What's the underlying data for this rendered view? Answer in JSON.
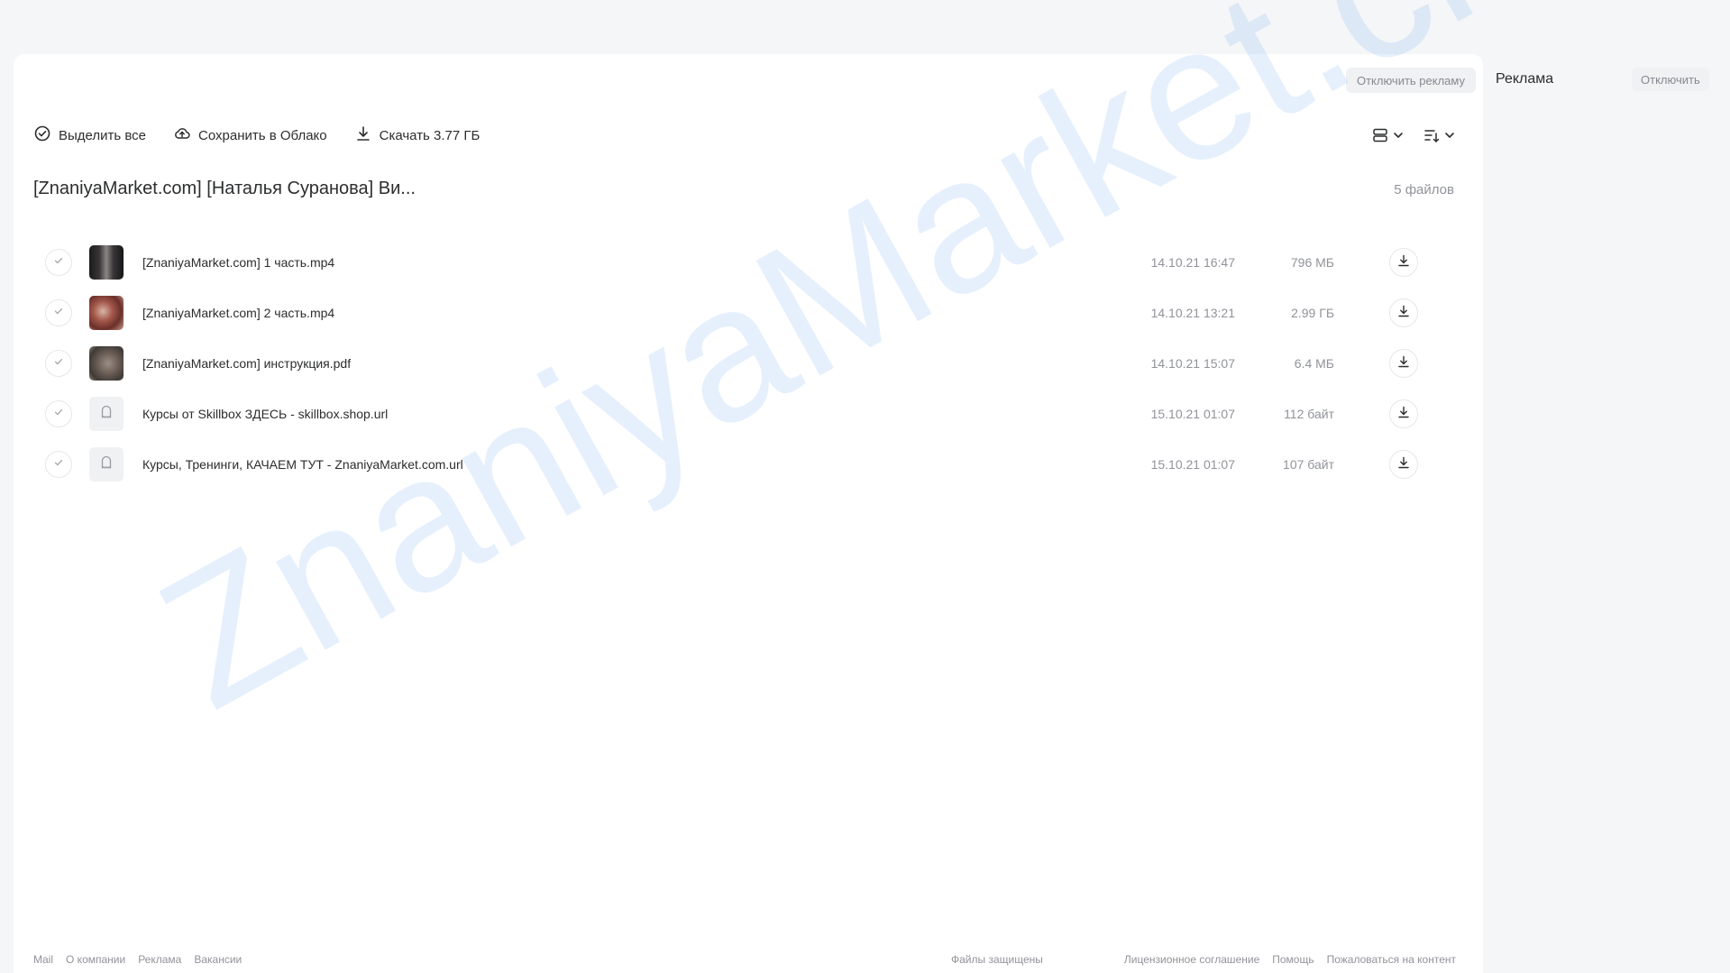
{
  "ads_bar": {
    "disable_ads": "Отключить рекламу"
  },
  "toolbar": {
    "select_all": "Выделить все",
    "save_to_cloud": "Сохранить в Облако",
    "download": "Скачать 3.77 ГБ"
  },
  "folder": {
    "title": "[ZnaniyaMarket.com] [Наталья Суранова] Ви...",
    "count": "5 файлов"
  },
  "files": [
    {
      "name": "[ZnaniyaMarket.com] 1 часть.mp4",
      "date": "14.10.21 16:47",
      "size": "796 МБ",
      "thumb": "video"
    },
    {
      "name": "[ZnaniyaMarket.com] 2 часть.mp4",
      "date": "14.10.21 13:21",
      "size": "2.99 ГБ",
      "thumb": "video"
    },
    {
      "name": "[ZnaniyaMarket.com] инструкция.pdf",
      "date": "14.10.21 15:07",
      "size": "6.4 МБ",
      "thumb": "pdf"
    },
    {
      "name": "Курсы от Skillbox ЗДЕСЬ - skillbox.shop.url",
      "date": "15.10.21 01:07",
      "size": "112 байт",
      "thumb": "file-icon"
    },
    {
      "name": "Курсы, Тренинги, КАЧАЕМ ТУТ - ZnaniyaMarket.com.url",
      "date": "15.10.21 01:07",
      "size": "107 байт",
      "thumb": "file-icon"
    }
  ],
  "footer": {
    "left": [
      "Mail",
      "О компании",
      "Реклама",
      "Вакансии"
    ],
    "middle": "Файлы защищены",
    "right": [
      "Лицензионное соглашение",
      "Помощь",
      "Пожаловаться на контент"
    ]
  },
  "sidebar": {
    "title": "Реклама",
    "disable": "Отключить"
  },
  "watermark": "ZnaniyaMarket.club",
  "colors": {
    "accent": "#1a7ae8",
    "text": "#2c2d2e",
    "muted": "#919399",
    "background": "#f5f6f8"
  }
}
